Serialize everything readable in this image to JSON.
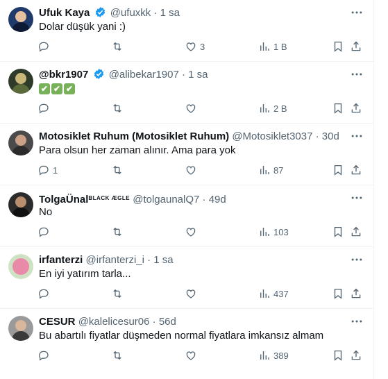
{
  "colors": {
    "text": "#0f1419",
    "muted": "#536471",
    "verified": "#1d9bf0",
    "divider": "#eff3f4"
  },
  "tweets": [
    {
      "name": "Ufuk Kaya",
      "verified": true,
      "handle": "@ufuxkk",
      "dot": "·",
      "time": "1 sa",
      "text": "Dolar düşük yani :)",
      "replies": "",
      "retweets": "",
      "likes": "3",
      "views": "1 B",
      "avatar_color": "#1f3a6b"
    },
    {
      "name": "@bkr1907",
      "verified": true,
      "handle": "@alibekar1907",
      "dot": "·",
      "time": "1 sa",
      "text": "",
      "checks": [
        "✔",
        "✔",
        "✔"
      ],
      "replies": "",
      "retweets": "",
      "likes": "",
      "views": "2 B",
      "avatar_color": "#2f3b2a"
    },
    {
      "name": "Motosiklet Ruhum (Motosiklet Ruhum)",
      "verified": false,
      "handle": "@Motosiklet3037",
      "dot": "·",
      "time": "30d",
      "text": "Para olsun her zaman alınır. Ama para yok",
      "replies": "1",
      "retweets": "",
      "likes": "",
      "views": "87",
      "avatar_color": "#4a4a4a"
    },
    {
      "name": "TolgaÜnal",
      "brand": "BLACK ÆGLE",
      "verified": false,
      "handle": "@tolgaunalQ7",
      "dot": "·",
      "time": "49d",
      "text": "No",
      "replies": "",
      "retweets": "",
      "likes": "",
      "views": "103",
      "avatar_color": "#2b2b2b"
    },
    {
      "name": "irfanterzi",
      "verified": false,
      "handle": "@irfanterzi_i",
      "dot": "·",
      "time": "1 sa",
      "text": "En iyi yatırım tarla...",
      "replies": "",
      "retweets": "",
      "likes": "",
      "views": "437",
      "avatar_color": "#e88aa8"
    },
    {
      "name": "CESUR",
      "verified": false,
      "handle": "@kalelicesur06",
      "dot": "·",
      "time": "56d",
      "text": "Bu abartılı fiyatlar düşmeden normal fiyatlara imkansız almam",
      "replies": "",
      "retweets": "",
      "likes": "",
      "views": "389",
      "avatar_color": "#7d7d7d"
    }
  ]
}
